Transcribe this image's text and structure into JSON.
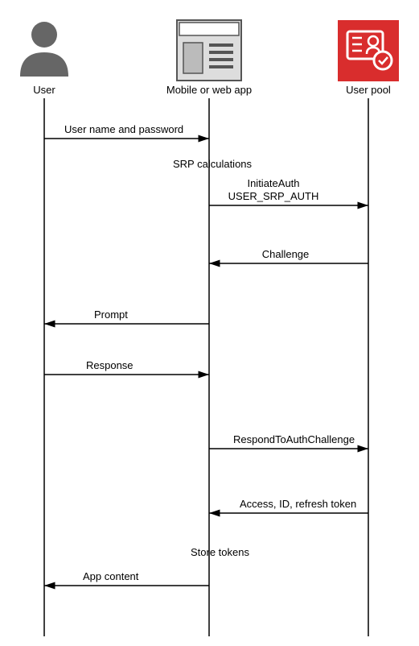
{
  "participants": {
    "user": {
      "label": "User"
    },
    "app": {
      "label": "Mobile or web app"
    },
    "pool": {
      "label": "User pool"
    }
  },
  "messages": {
    "m1": "User name and password",
    "m2": "SRP calculations",
    "m3a": "InitiateAuth",
    "m3b": "USER_SRP_AUTH",
    "m4": "Challenge",
    "m5": "Prompt",
    "m6": "Response",
    "m7": "RespondToAuthChallenge",
    "m8": "Access, ID, refresh token",
    "m9": "Store tokens",
    "m10": "App content"
  }
}
